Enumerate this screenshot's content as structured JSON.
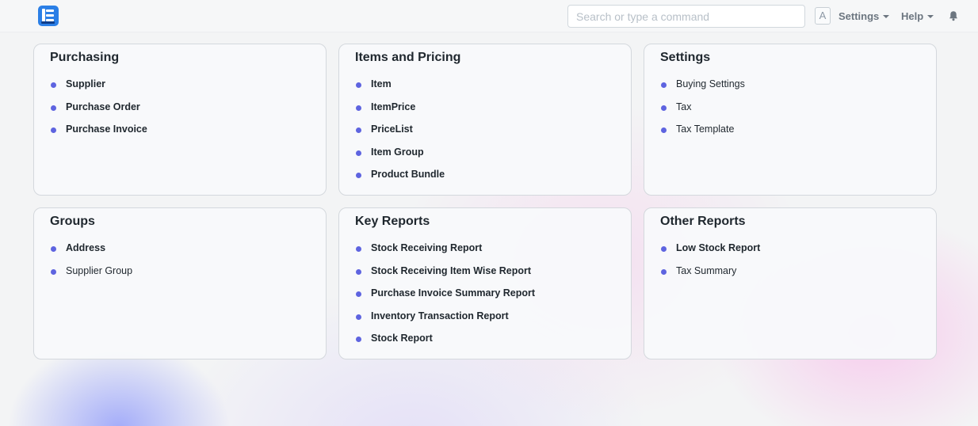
{
  "navbar": {
    "search_placeholder": "Search or type a command",
    "avatar_initial": "A",
    "settings_label": "Settings",
    "help_label": "Help"
  },
  "colors": {
    "bullet": "#5e64e0",
    "logo": "#2b7fe6"
  },
  "cards": [
    {
      "title": "Purchasing",
      "links": [
        {
          "label": "Supplier",
          "bold": true
        },
        {
          "label": "Purchase Order",
          "bold": true
        },
        {
          "label": "Purchase Invoice",
          "bold": true
        }
      ]
    },
    {
      "title": "Items and Pricing",
      "links": [
        {
          "label": "Item",
          "bold": true
        },
        {
          "label": "ItemPrice",
          "bold": true
        },
        {
          "label": "PriceList",
          "bold": true
        },
        {
          "label": "Item Group",
          "bold": true
        },
        {
          "label": "Product Bundle",
          "bold": true
        }
      ]
    },
    {
      "title": "Settings",
      "links": [
        {
          "label": "Buying Settings",
          "bold": false
        },
        {
          "label": "Tax",
          "bold": false
        },
        {
          "label": "Tax Template",
          "bold": false
        }
      ]
    },
    {
      "title": "Groups",
      "links": [
        {
          "label": "Address",
          "bold": true
        },
        {
          "label": "Supplier Group",
          "bold": false
        }
      ]
    },
    {
      "title": "Key Reports",
      "links": [
        {
          "label": "Stock Receiving Report",
          "bold": true
        },
        {
          "label": "Stock Receiving Item Wise Report",
          "bold": true
        },
        {
          "label": "Purchase Invoice Summary Report",
          "bold": true
        },
        {
          "label": "Inventory Transaction Report",
          "bold": true
        },
        {
          "label": "Stock Report",
          "bold": true
        }
      ]
    },
    {
      "title": "Other Reports",
      "links": [
        {
          "label": "Low Stock Report",
          "bold": true
        },
        {
          "label": "Tax Summary",
          "bold": false
        }
      ]
    }
  ]
}
